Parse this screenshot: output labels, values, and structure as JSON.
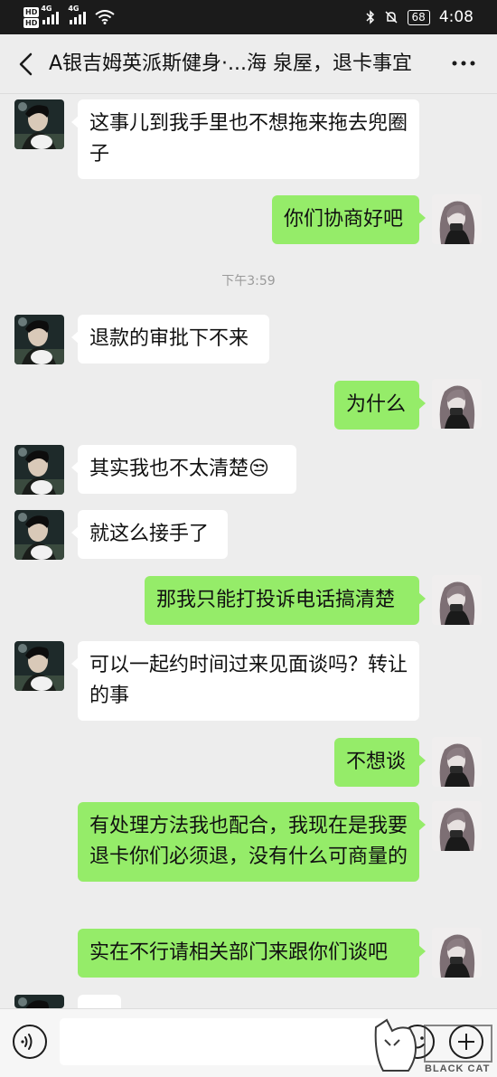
{
  "status_bar": {
    "network_badges": [
      "HD",
      "HD"
    ],
    "signal_labels": [
      "4G",
      "4G"
    ],
    "battery": "68",
    "time": "4:08"
  },
  "header": {
    "title": "A银吉姆英派斯健身·...海 泉屋，退卡事宜"
  },
  "messages": [
    {
      "side": "left",
      "text": "这事儿到我手里也不想拖来拖去兜圈子"
    },
    {
      "side": "right",
      "text": "你们协商好吧"
    },
    {
      "type": "timestamp",
      "text": "下午3:59"
    },
    {
      "side": "left",
      "text": "退款的审批下不来"
    },
    {
      "side": "right",
      "text": "为什么"
    },
    {
      "side": "left",
      "text": "其实我也不太清楚😒"
    },
    {
      "side": "left",
      "text": "就这么接手了"
    },
    {
      "side": "right",
      "text": "那我只能打投诉电话搞清楚"
    },
    {
      "side": "left",
      "text": "可以一起约时间过来见面谈吗？转让的事"
    },
    {
      "side": "right",
      "text": "不想谈"
    },
    {
      "side": "right",
      "text": "有处理方法我也配合，我现在是我要退卡你们必须退，没有什么可商量的"
    },
    {
      "side": "right",
      "text": "实在不行请相关部门来跟你们谈吧"
    }
  ],
  "watermark": {
    "text": "BLACK CAT"
  },
  "colors": {
    "background": "#ededed",
    "bubble_self": "#95ec69",
    "bubble_other": "#ffffff",
    "status_bar": "#1b1b1b"
  },
  "icons": {
    "back": "chevron-left-icon",
    "more": "more-dots-icon",
    "voice": "voice-icon",
    "emoji": "emoji-icon",
    "plus": "plus-icon"
  }
}
